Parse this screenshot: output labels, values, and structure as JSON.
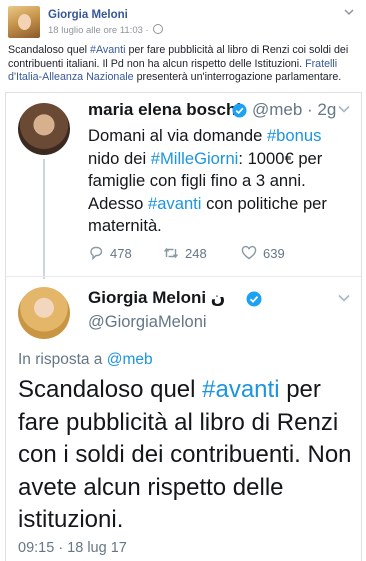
{
  "post": {
    "author": "Giorgia Meloni",
    "meta": "18 luglio alle ore 11:03 ·",
    "text_part1": "Scandaloso quel ",
    "text_link1": "#Avanti",
    "text_part2": " per fare pubblicità al libro di Renzi coi soldi dei contribuenti italiani. Il Pd non ha alcun rispetto delle Istituzioni. ",
    "text_link2": "Fratelli d'Italia-Alleanza Nazionale",
    "text_part3": " presenterà un'interrogazione parlamentare."
  },
  "quoted_tweet": {
    "name": "maria elena boschi",
    "handle": "@meb · 2g",
    "text_a": "Domani al via domande ",
    "tag_bonus": "#bonus",
    "text_b": " nido dei ",
    "tag_millegiorni": "#MilleGiorni",
    "text_c": ": 1000€ per famiglie con figli fino a 3 anni. Adesso ",
    "tag_avanti": "#avanti",
    "text_d": " con politiche per maternità.",
    "replies": "478",
    "retweets": "248",
    "likes": "639"
  },
  "main_tweet": {
    "name": "Giorgia Meloni",
    "name_suffix": "ن",
    "handle": "@GiorgiaMeloni",
    "reply_label": "In risposta a ",
    "reply_handle": "@meb",
    "text_a": "Scandaloso quel ",
    "tag_avanti": "#avanti",
    "text_b": " per fare pubblicità al libro di Renzi con i soldi dei contribuenti. Non avete alcun rispetto delle istituzioni.",
    "timestamp": "09:15 · 18 lug 17"
  },
  "colors": {
    "fb_link": "#365899",
    "twitter_blue": "#1b95e0",
    "muted": "#657786"
  },
  "icons": [
    "globe-icon",
    "chevron-down-icon",
    "verified-badge-icon",
    "reply-icon",
    "retweet-icon",
    "like-icon"
  ]
}
